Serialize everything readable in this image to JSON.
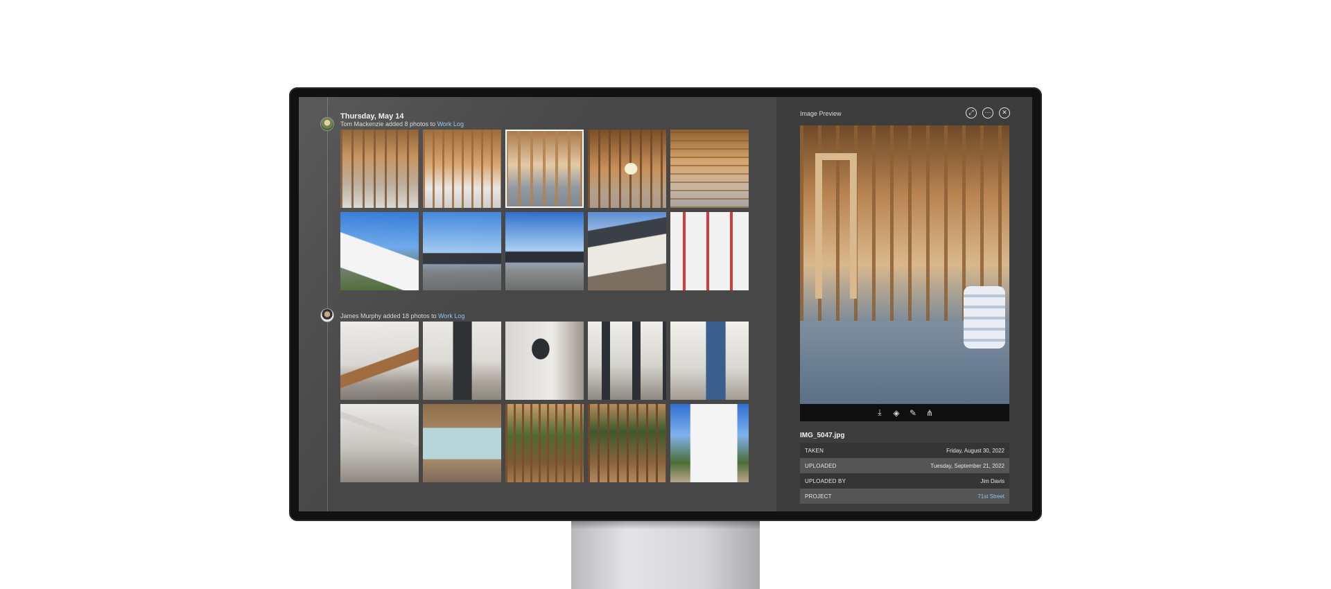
{
  "feed": {
    "day_title": "Thursday, May 14",
    "activities": [
      {
        "user": "Tom Mackenzie",
        "text_before": "Tom Mackenzie added 8 photos to ",
        "link": "Work Log"
      },
      {
        "user": "James Murphy",
        "text_before": "James Murphy added 18 photos to ",
        "link": "Work Log"
      }
    ]
  },
  "preview_panel": {
    "title": "Image Preview",
    "header_icons": [
      "expand-icon",
      "more-icon",
      "close-icon"
    ],
    "toolbar_icons": [
      "download-icon",
      "rotate-icon",
      "edit-icon",
      "share-icon"
    ],
    "file_name": "IMG_5047.jpg",
    "details": [
      {
        "label": "TAKEN",
        "value": "Friday, August 30, 2022"
      },
      {
        "label": "UPLOADED",
        "value": "Tuesday, September 21, 2022"
      },
      {
        "label": "UPLOADED BY",
        "value": "Jim Davis"
      },
      {
        "label": "PROJECT",
        "value": "71st Street"
      }
    ]
  },
  "colors": {
    "link": "#8dc6f0",
    "screen_bg": "#474747",
    "panel_bg": "#3d3d3d"
  }
}
